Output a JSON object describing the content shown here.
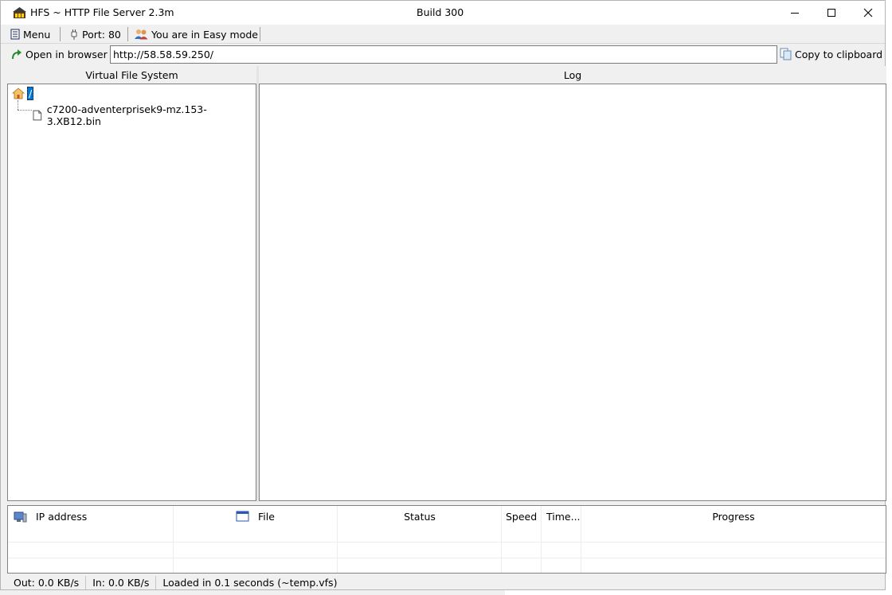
{
  "window": {
    "title": "HFS ~ HTTP File Server 2.3m",
    "build": "Build 300"
  },
  "toolbar": {
    "menu_label": "Menu",
    "port_label": "Port: 80",
    "mode_label": "You are in Easy mode"
  },
  "address_bar": {
    "open_label": "Open in browser",
    "url": "http://58.58.59.250/",
    "copy_label": "Copy to clipboard"
  },
  "vfs": {
    "header": "Virtual File System",
    "root_label": "/",
    "files": [
      "c7200-adventerprisek9-mz.153-3.XB12.bin"
    ]
  },
  "log": {
    "header": "Log"
  },
  "connections": {
    "columns": [
      "IP address",
      "File",
      "Status",
      "Speed",
      "Time...",
      "Progress"
    ]
  },
  "statusbar": {
    "out": "Out: 0.0 KB/s",
    "in": "In: 0.0 KB/s",
    "loaded": "Loaded in 0.1 seconds (~temp.vfs)"
  },
  "colors": {
    "selection": "#0078d7",
    "window_bg": "#f0f0f0",
    "pane_border": "#828282"
  }
}
